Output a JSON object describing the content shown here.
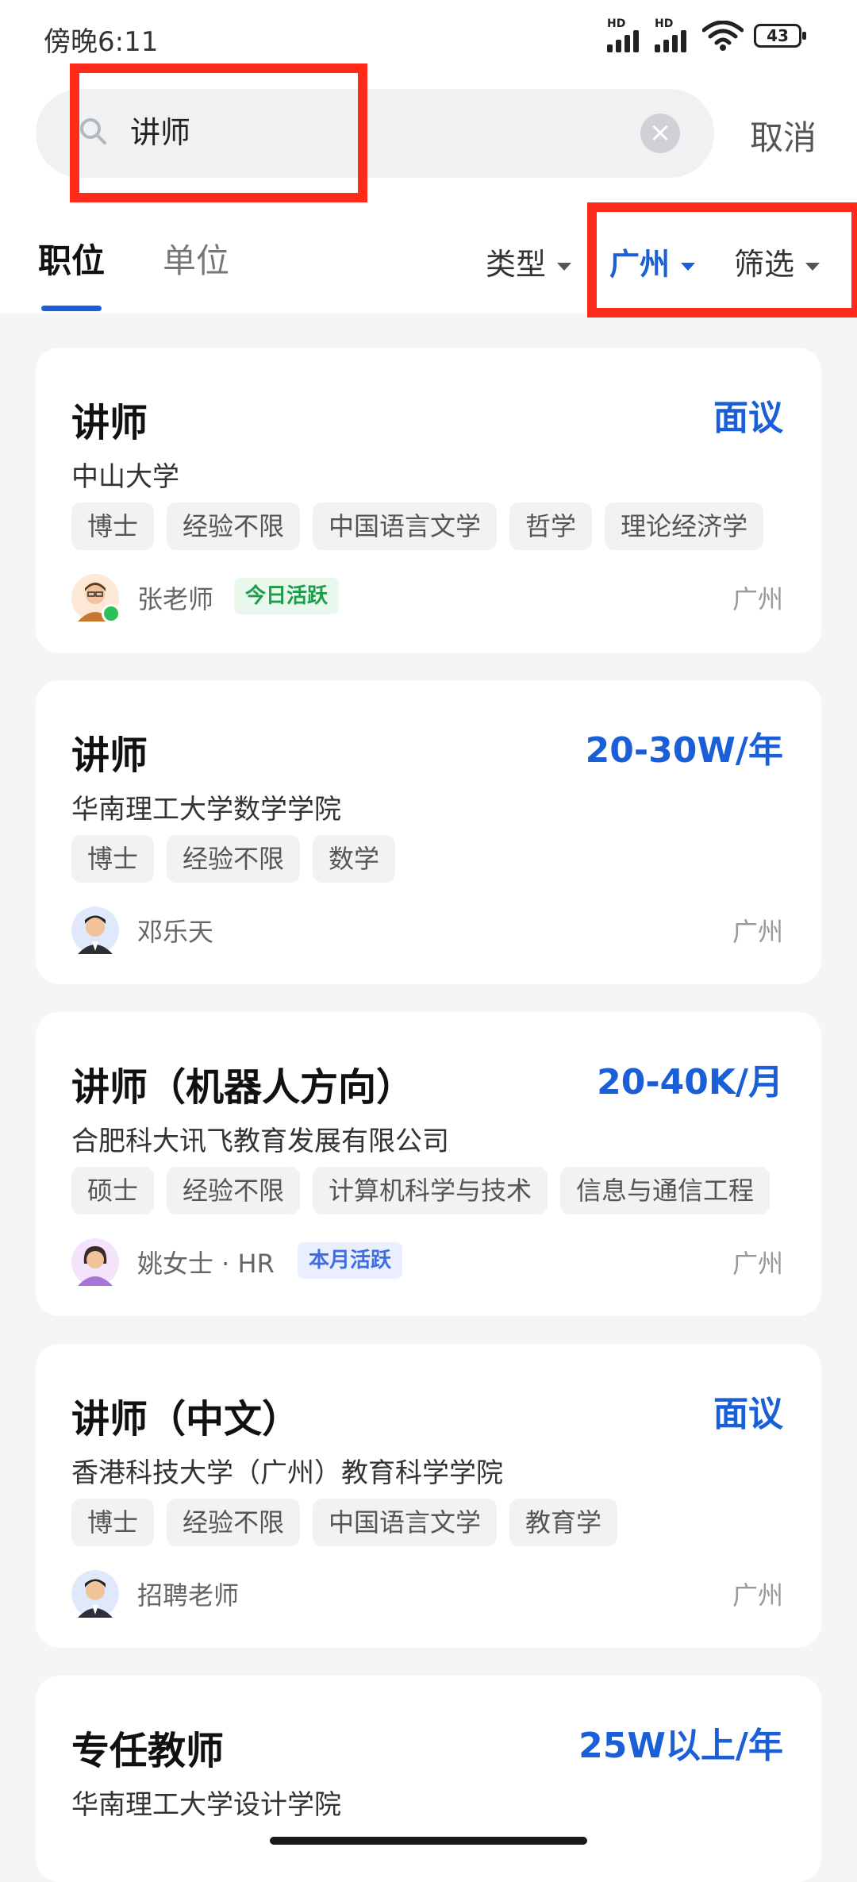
{
  "status_bar": {
    "time": "傍晚6:11",
    "signal1": "HD",
    "signal2": "HD",
    "battery": "43"
  },
  "search": {
    "query": "讲师",
    "clear": "×",
    "cancel": "取消"
  },
  "tabs": [
    {
      "label": "职位",
      "active": true
    },
    {
      "label": "单位",
      "active": false
    }
  ],
  "filters": {
    "type": "类型",
    "city": "广州",
    "filter": "筛选"
  },
  "jobs": [
    {
      "title": "讲师",
      "salary": "面议",
      "company": "中山大学",
      "tags": [
        "博士",
        "经验不限",
        "中国语言文学",
        "哲学",
        "理论经济学"
      ],
      "recruiter": "张老师",
      "badge": "今日活跃",
      "location": "广州"
    },
    {
      "title": "讲师",
      "salary": "20-30W/年",
      "company": "华南理工大学数学学院",
      "tags": [
        "博士",
        "经验不限",
        "数学"
      ],
      "recruiter": "邓乐天",
      "location": "广州"
    },
    {
      "title": "讲师（机器人方向）",
      "salary": "20-40K/月",
      "company": "合肥科大讯飞教育发展有限公司",
      "tags": [
        "硕士",
        "经验不限",
        "计算机科学与技术",
        "信息与通信工程"
      ],
      "recruiter": "姚女士 · HR",
      "badge": "本月活跃",
      "location": "广州"
    },
    {
      "title": "讲师（中文）",
      "salary": "面议",
      "company": "香港科技大学（广州）教育科学学院",
      "tags": [
        "博士",
        "经验不限",
        "中国语言文学",
        "教育学"
      ],
      "recruiter": "招聘老师",
      "location": "广州"
    },
    {
      "title": "专任教师",
      "salary": "25W以上/年",
      "company": "华南理工大学设计学院"
    }
  ],
  "colors": {
    "accent": "#1a5fd8",
    "highlight": "#ff2a1a",
    "background": "#f4f5f7"
  }
}
